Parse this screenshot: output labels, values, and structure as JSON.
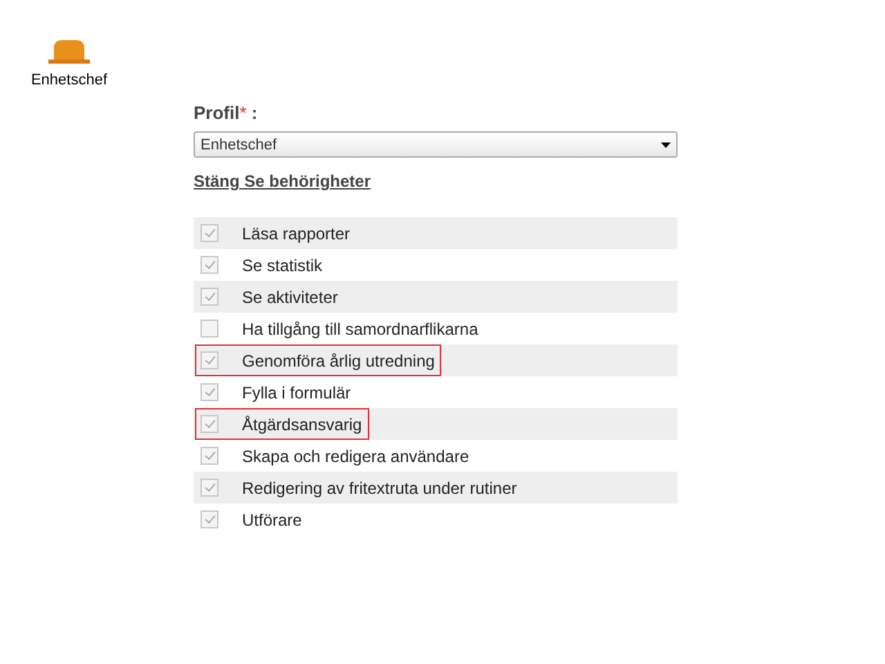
{
  "role_icon": {
    "label": "Enhetschef"
  },
  "profile": {
    "label": "Profil",
    "required_mark": "*",
    "colon": ":",
    "value": "Enhetschef"
  },
  "toggle_link": "Stäng Se behörigheter",
  "permissions": [
    {
      "label": "Läsa rapporter",
      "checked": true,
      "highlighted": false
    },
    {
      "label": "Se statistik",
      "checked": true,
      "highlighted": false
    },
    {
      "label": "Se aktiviteter",
      "checked": true,
      "highlighted": false
    },
    {
      "label": "Ha tillgång till samordnarflikarna",
      "checked": false,
      "highlighted": false
    },
    {
      "label": "Genomföra årlig utredning",
      "checked": true,
      "highlighted": true
    },
    {
      "label": "Fylla i formulär",
      "checked": true,
      "highlighted": false
    },
    {
      "label": "Åtgärdsansvarig",
      "checked": true,
      "highlighted": true
    },
    {
      "label": "Skapa och redigera användare",
      "checked": true,
      "highlighted": false
    },
    {
      "label": "Redigering av fritextruta under rutiner",
      "checked": true,
      "highlighted": false
    },
    {
      "label": "Utförare",
      "checked": true,
      "highlighted": false
    }
  ]
}
